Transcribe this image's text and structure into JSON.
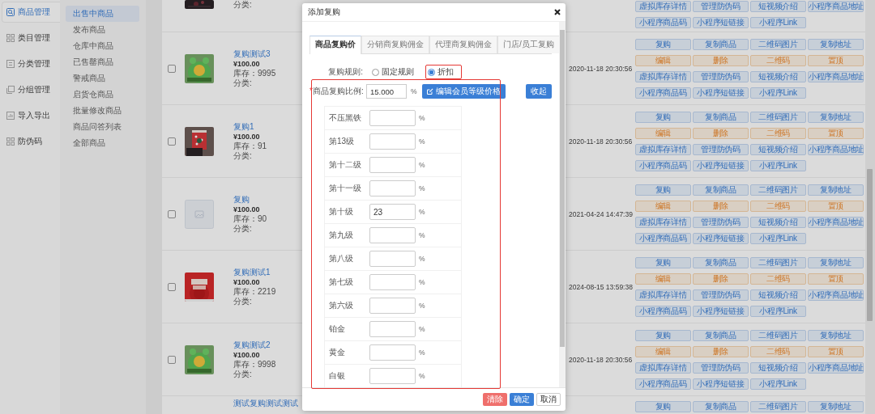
{
  "nav": [
    {
      "label": "商品管理",
      "selected": true
    },
    {
      "label": "类目管理",
      "selected": false
    },
    {
      "label": "分类管理",
      "selected": false
    },
    {
      "label": "分组管理",
      "selected": false
    },
    {
      "label": "导入导出",
      "selected": false
    },
    {
      "label": "防伪码",
      "selected": false
    }
  ],
  "submenu": [
    {
      "label": "出售中商品",
      "selected": true
    },
    {
      "label": "发布商品",
      "selected": false
    },
    {
      "label": "仓库中商品",
      "selected": false
    },
    {
      "label": "已售罄商品",
      "selected": false
    },
    {
      "label": "警戒商品",
      "selected": false
    },
    {
      "label": "启货仓商品",
      "selected": false
    },
    {
      "label": "批量修改商品",
      "selected": false
    },
    {
      "label": "商品问答列表",
      "selected": false
    },
    {
      "label": "全部商品",
      "selected": false
    }
  ],
  "products": [
    {
      "kind": "partial_bottom",
      "image": {
        "kind": "picture"
      },
      "category": "分类:",
      "button_rows": [
        {
          "kind": "info",
          "labels": [
            "虚拟库存详情",
            "管理防伪码",
            "短视频介绍",
            "小程序商品地址"
          ]
        },
        {
          "kind": "info",
          "labels": [
            "小程序商品码",
            "小程序短链接",
            "小程序Link"
          ]
        }
      ]
    },
    {
      "kind": "full",
      "checked": false,
      "image": {
        "kind": "picture"
      },
      "name": "复购测试3",
      "price": "¥100.00",
      "stock": "库存：9995",
      "category": "分类:",
      "date": "2020-11-18 20:30:56",
      "button_rows": [
        {
          "kind": "info",
          "labels": [
            "复购",
            "复制商品",
            "二维码图片",
            "复制地址"
          ]
        },
        {
          "kind": "warning",
          "labels": [
            "编辑",
            "删除",
            "二维码",
            "置顶"
          ]
        },
        {
          "kind": "info",
          "labels": [
            "虚拟库存详情",
            "管理防伪码",
            "短视频介绍",
            "小程序商品地址"
          ]
        },
        {
          "kind": "info",
          "labels": [
            "小程序商品码",
            "小程序短链接",
            "小程序Link"
          ]
        }
      ]
    },
    {
      "kind": "full",
      "checked": false,
      "image": {
        "kind": "picture"
      },
      "name": "复购1",
      "price": "¥100.00",
      "stock": "库存：91",
      "category": "分类:",
      "date": "2020-11-18 20:30:56",
      "button_rows": [
        {
          "kind": "info",
          "labels": [
            "复购",
            "复制商品",
            "二维码图片",
            "复制地址"
          ]
        },
        {
          "kind": "warning",
          "labels": [
            "编辑",
            "删除",
            "二维码",
            "置顶"
          ]
        },
        {
          "kind": "info",
          "labels": [
            "虚拟库存详情",
            "管理防伪码",
            "短视频介绍",
            "小程序商品地址"
          ]
        },
        {
          "kind": "info",
          "labels": [
            "小程序商品码",
            "小程序短链接",
            "小程序Link"
          ]
        }
      ]
    },
    {
      "kind": "full",
      "checked": false,
      "image": {
        "kind": "placeholder"
      },
      "name": "复购",
      "price": "¥100.00",
      "stock": "库存：90",
      "category": "分类:",
      "date": "2021-04-24 14:47:39",
      "button_rows": [
        {
          "kind": "info",
          "labels": [
            "复购",
            "复制商品",
            "二维码图片",
            "复制地址"
          ]
        },
        {
          "kind": "warning",
          "labels": [
            "编辑",
            "删除",
            "二维码",
            "置顶"
          ]
        },
        {
          "kind": "info",
          "labels": [
            "虚拟库存详情",
            "管理防伪码",
            "短视频介绍",
            "小程序商品地址"
          ]
        },
        {
          "kind": "info",
          "labels": [
            "小程序商品码",
            "小程序短链接",
            "小程序Link"
          ]
        }
      ]
    },
    {
      "kind": "full",
      "checked": false,
      "image": {
        "kind": "picture"
      },
      "name": "复购测试1",
      "price": "¥100.00",
      "stock": "库存：2219",
      "category": "分类:",
      "date": "2024-08-15 13:59:38",
      "button_rows": [
        {
          "kind": "info",
          "labels": [
            "复购",
            "复制商品",
            "二维码图片",
            "复制地址"
          ]
        },
        {
          "kind": "warning",
          "labels": [
            "编辑",
            "删除",
            "二维码",
            "置顶"
          ]
        },
        {
          "kind": "info",
          "labels": [
            "虚拟库存详情",
            "管理防伪码",
            "短视频介绍",
            "小程序商品地址"
          ]
        },
        {
          "kind": "info",
          "labels": [
            "小程序商品码",
            "小程序短链接",
            "小程序Link"
          ]
        }
      ]
    },
    {
      "kind": "full",
      "checked": false,
      "image": {
        "kind": "picture"
      },
      "name": "复购测试2",
      "price": "¥100.00",
      "stock": "库存：9998",
      "category": "分类:",
      "date": "2020-11-18 20:30:56",
      "button_rows": [
        {
          "kind": "info",
          "labels": [
            "复购",
            "复制商品",
            "二维码图片",
            "复制地址"
          ]
        },
        {
          "kind": "warning",
          "labels": [
            "编辑",
            "删除",
            "二维码",
            "置顶"
          ]
        },
        {
          "kind": "info",
          "labels": [
            "虚拟库存详情",
            "管理防伪码",
            "短视频介绍",
            "小程序商品地址"
          ]
        },
        {
          "kind": "info",
          "labels": [
            "小程序商品码",
            "小程序短链接",
            "小程序Link"
          ]
        }
      ]
    },
    {
      "kind": "partial_top",
      "name": "测试复购测试测试",
      "button_rows": [
        {
          "kind": "info",
          "labels": [
            "复购",
            "复制商品",
            "二维码图片",
            "复制地址"
          ]
        }
      ]
    }
  ],
  "dialog": {
    "title": "添加复购",
    "tabs": [
      {
        "label": "商品复购价",
        "selected": true
      },
      {
        "label": "分销商复购佣金",
        "selected": false
      },
      {
        "label": "代理商复购佣金",
        "selected": false
      },
      {
        "label": "门店/员工复购",
        "selected": false
      }
    ],
    "rule": {
      "label": "复购规则:",
      "options": [
        {
          "label": "固定规则",
          "selected": false,
          "highlighted": false
        },
        {
          "label": "折扣",
          "selected": true,
          "highlighted": true
        }
      ]
    },
    "ratio": {
      "required_mark": "*",
      "label": "商品复购比例:",
      "value": "15.000",
      "unit": "%",
      "edit_button": "编辑会员等级价格",
      "collapse_button": "收起"
    },
    "levels_highlighted": true,
    "levels": [
      {
        "label": "不压黑铁",
        "unit": "%"
      },
      {
        "label": "第13级",
        "unit": "%"
      },
      {
        "label": "第十二级",
        "unit": "%"
      },
      {
        "label": "第十一级",
        "unit": "%"
      },
      {
        "label": "第十级",
        "value": "23",
        "unit": "%"
      },
      {
        "label": "第九级",
        "unit": "%"
      },
      {
        "label": "第八级",
        "unit": "%"
      },
      {
        "label": "第七级",
        "unit": "%"
      },
      {
        "label": "第六级",
        "unit": "%"
      },
      {
        "label": "铂金",
        "unit": "%"
      },
      {
        "label": "黄金",
        "unit": "%"
      },
      {
        "label": "白银",
        "unit": "%"
      }
    ],
    "buttons": [
      {
        "label": "清除",
        "kind": "danger"
      },
      {
        "label": "确定",
        "kind": "primary"
      },
      {
        "label": "取消",
        "kind": "default"
      }
    ]
  }
}
